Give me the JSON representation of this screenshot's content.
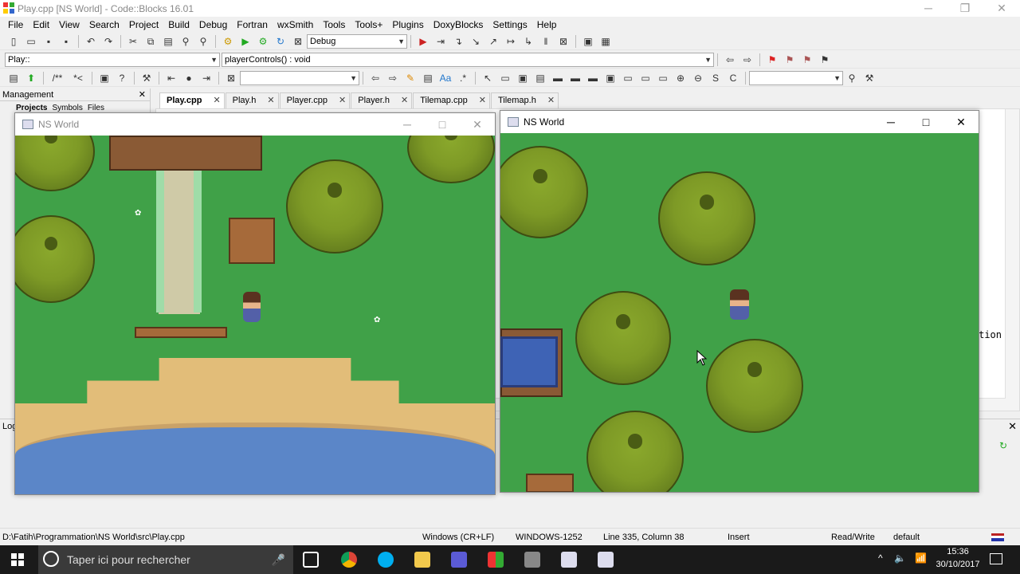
{
  "window": {
    "title": "Play.cpp [NS World] - Code::Blocks 16.01",
    "min": "─",
    "max": "❐",
    "close": "✕"
  },
  "menu": [
    "File",
    "Edit",
    "View",
    "Search",
    "Project",
    "Build",
    "Debug",
    "Fortran",
    "wxSmith",
    "Tools",
    "Tools+",
    "Plugins",
    "DoxyBlocks",
    "Settings",
    "Help"
  ],
  "toolbar": {
    "build_target": "Debug",
    "scope": "Play::",
    "function": "playerControls() : void"
  },
  "management": {
    "title": "Management",
    "close": "✕",
    "tabs": [
      "Projects",
      "Symbols",
      "Files"
    ]
  },
  "editor_tabs": [
    {
      "label": "Play.cpp",
      "active": true
    },
    {
      "label": "Play.h"
    },
    {
      "label": "Player.cpp"
    },
    {
      "label": "Player.h"
    },
    {
      "label": "Tilemap.cpp"
    },
    {
      "label": "Tilemap.h"
    }
  ],
  "editor": {
    "visible_text": "ction"
  },
  "logs": {
    "title": "Log"
  },
  "game_windows": [
    {
      "title": "NS World",
      "min": "─",
      "max": "□",
      "close": "✕"
    },
    {
      "title": "NS World",
      "min": "─",
      "max": "□",
      "close": "✕"
    }
  ],
  "status": {
    "path": "D:\\Fatih\\Programmation\\NS World\\src\\Play.cpp",
    "eol": "Windows (CR+LF)",
    "encoding": "WINDOWS-1252",
    "position": "Line 335, Column 38",
    "mode": "Insert",
    "access": "Read/Write",
    "profile": "default"
  },
  "taskbar": {
    "search_placeholder": "Taper ici pour rechercher",
    "time": "15:36",
    "date": "30/10/2017"
  },
  "colors": {
    "grass": "#40a148",
    "water": "#5b86c8",
    "sand": "#e2bd79"
  }
}
